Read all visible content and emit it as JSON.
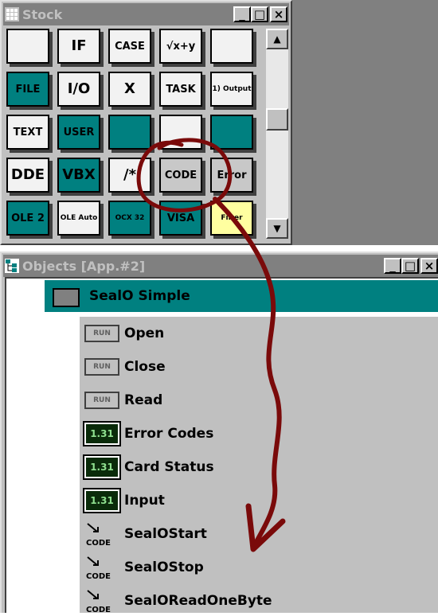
{
  "stock_window": {
    "title": "Stock",
    "buttons": {
      "minimize": "_",
      "maximize": "□",
      "close": "×"
    },
    "tiles": [
      {
        "name": "loop-icon",
        "text": "",
        "style": "white"
      },
      {
        "name": "if-icon",
        "text": "IF",
        "style": "white"
      },
      {
        "name": "case-icon",
        "text": "CASE",
        "style": "white"
      },
      {
        "name": "formula-icon",
        "text": "√x+y",
        "style": "white"
      },
      {
        "name": "timer-icon",
        "text": "",
        "style": "white"
      },
      {
        "name": "file-icon",
        "text": "FILE",
        "style": "teal"
      },
      {
        "name": "io-icon",
        "text": "I/O",
        "style": "white"
      },
      {
        "name": "x-box-icon",
        "text": "X",
        "style": "white"
      },
      {
        "name": "task-icon",
        "text": "TASK",
        "style": "white"
      },
      {
        "name": "list-icon",
        "text": "1) Output",
        "style": "white"
      },
      {
        "name": "text-icon",
        "text": "TEXT",
        "style": "white"
      },
      {
        "name": "user-icon",
        "text": "USER",
        "style": "teal"
      },
      {
        "name": "graph-icon",
        "text": "",
        "style": "teal"
      },
      {
        "name": "eraser-icon",
        "text": "",
        "style": "white"
      },
      {
        "name": "window-icon",
        "text": "",
        "style": "teal"
      },
      {
        "name": "dde-icon",
        "text": "DDE",
        "style": "white"
      },
      {
        "name": "vbx-icon",
        "text": "VBX",
        "style": "teal"
      },
      {
        "name": "comment-icon",
        "text": "/*",
        "style": "white"
      },
      {
        "name": "code-icon",
        "text": "CODE",
        "style": "gray"
      },
      {
        "name": "error-icon",
        "text": "Error",
        "style": "gray"
      },
      {
        "name": "ole2-icon",
        "text": "OLE 2",
        "style": "teal"
      },
      {
        "name": "ole-auto-icon",
        "text": "OLE Auto",
        "style": "white"
      },
      {
        "name": "ocx32-icon",
        "text": "OCX 32",
        "style": "teal"
      },
      {
        "name": "visa-icon",
        "text": "VISA",
        "style": "teal"
      },
      {
        "name": "filter-icon",
        "text": "Filter",
        "style": "yellow"
      }
    ]
  },
  "objects_window": {
    "title": "Objects [App.#2]",
    "buttons": {
      "minimize": "_",
      "maximize": "□",
      "close": "×"
    },
    "root": {
      "label": "SealO Simple"
    },
    "items": [
      {
        "type": "run",
        "badge": "RUN",
        "label": "Open"
      },
      {
        "type": "run",
        "badge": "RUN",
        "label": "Close"
      },
      {
        "type": "run",
        "badge": "RUN",
        "label": "Read"
      },
      {
        "type": "num",
        "badge": "1.31",
        "label": "Error Codes"
      },
      {
        "type": "num",
        "badge": "1.31",
        "label": "Card Status"
      },
      {
        "type": "num",
        "badge": "1.31",
        "label": "Input"
      },
      {
        "type": "code",
        "badge": "CODE",
        "label": "SealOStart"
      },
      {
        "type": "code",
        "badge": "CODE",
        "label": "SealOStop"
      },
      {
        "type": "code",
        "badge": "CODE",
        "label": "SealOReadOneByte"
      }
    ]
  },
  "colors": {
    "annotation": "#7a0a0a",
    "teal": "#008080",
    "titlebar_inactive": "#808080"
  }
}
